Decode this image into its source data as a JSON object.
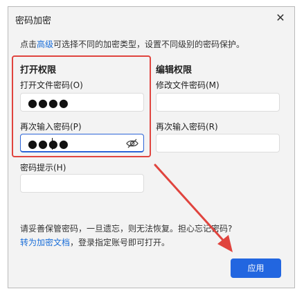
{
  "dialog": {
    "title": "密码加密",
    "close_glyph": "✕"
  },
  "hint": {
    "prefix": "点击",
    "link": "高级",
    "suffix": "可选择不同的加密类型，设置不同级别的密码保护。"
  },
  "open_permission": {
    "title": "打开权限",
    "password_label": "打开文件密码(O)",
    "password_value": "●●●●",
    "confirm_label": "再次输入密码(P)",
    "confirm_value": "●●●●",
    "hint_label": "密码提示(H)",
    "hint_value": ""
  },
  "edit_permission": {
    "title": "编辑权限",
    "password_label": "修改文件密码(M)",
    "password_value": "",
    "confirm_label": "再次输入密码(R)",
    "confirm_value": ""
  },
  "footer": {
    "line1": "请妥善保管密码，一旦遗忘，则无法恢复。担心忘记密码?",
    "link": "转为加密文档",
    "line2_suffix": "，登录指定账号即可打开。",
    "apply_label": "应用"
  },
  "colors": {
    "accent": "#2266e0",
    "highlight": "#e0443e"
  }
}
